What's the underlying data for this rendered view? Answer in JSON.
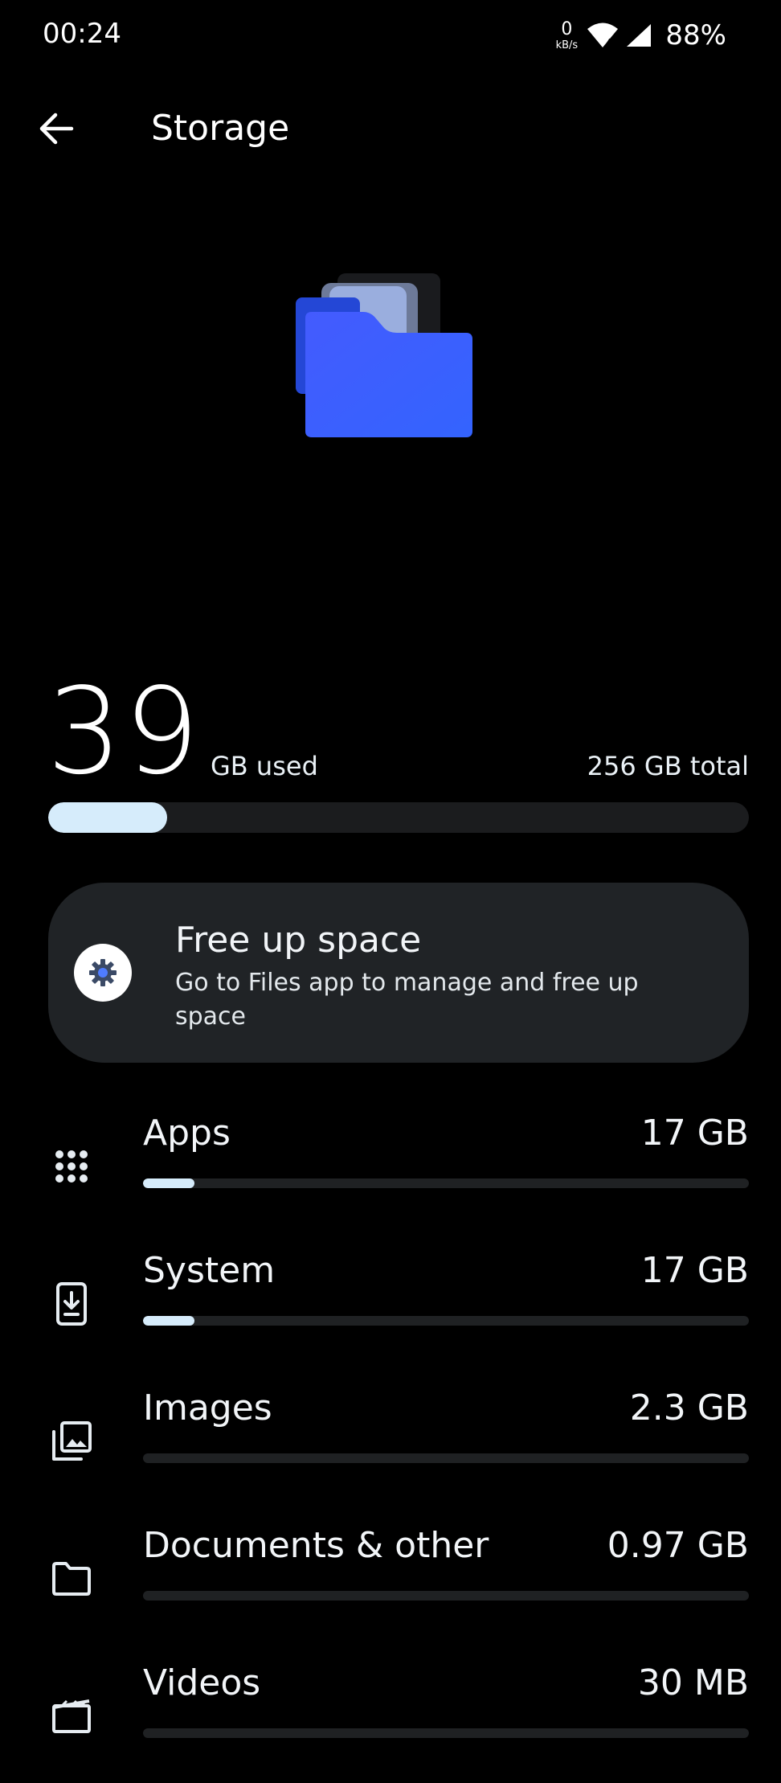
{
  "status_bar": {
    "time": "00:24",
    "net_speed_value": "0",
    "net_speed_unit": "kB/s",
    "battery": "88%"
  },
  "toolbar": {
    "title": "Storage"
  },
  "summary": {
    "used_value": "39",
    "used_label": "GB used",
    "total_label": "256 GB total",
    "used_fraction": 0.17
  },
  "free_up": {
    "title": "Free up space",
    "description": "Go to Files app to manage and free up space"
  },
  "categories": [
    {
      "name": "Apps",
      "size": "17 GB",
      "fraction": 0.085,
      "icon": "apps-grid-icon"
    },
    {
      "name": "System",
      "size": "17 GB",
      "fraction": 0.085,
      "icon": "system-update-icon"
    },
    {
      "name": "Images",
      "size": "2.3 GB",
      "fraction": 0.0,
      "icon": "images-icon"
    },
    {
      "name": "Documents & other",
      "size": "0.97 GB",
      "fraction": 0.0,
      "icon": "folder-icon"
    },
    {
      "name": "Videos",
      "size": "30 MB",
      "fraction": 0.0,
      "icon": "movie-icon"
    }
  ],
  "colors": {
    "background": "#000000",
    "card": "#202326",
    "bar_track": "#1b1c1e",
    "bar_fill": "#d6ecfb",
    "folder_blue": "#3d5afe"
  }
}
